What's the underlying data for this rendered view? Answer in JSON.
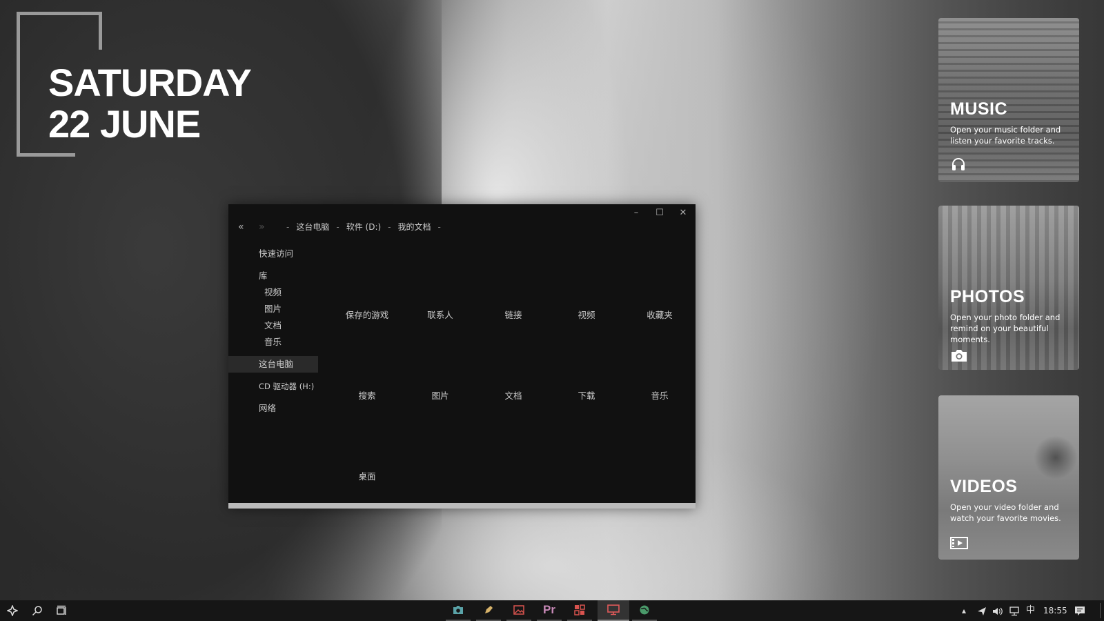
{
  "date_widget": {
    "line1": "SATURDAY",
    "line2": "22 JUNE"
  },
  "explorer": {
    "nav": {
      "back": "«",
      "forward": "»"
    },
    "breadcrumb": [
      "这台电脑",
      "软件 (D:)",
      "我的文档"
    ],
    "sidebar": {
      "quick_access": "快速访问",
      "libraries": "库",
      "lib_items": [
        "视频",
        "图片",
        "文档",
        "音乐"
      ],
      "this_pc": "这台电脑",
      "cd_drive": "CD 驱动器 (H:)",
      "network": "网络"
    },
    "folders": [
      "保存的游戏",
      "联系人",
      "链接",
      "视频",
      "收藏夹",
      "搜索",
      "图片",
      "文档",
      "下载",
      "音乐",
      "桌面"
    ]
  },
  "cards": {
    "music": {
      "title": "MUSIC",
      "desc": "Open your music folder and listen your favorite tracks.",
      "icon": "headphones-icon"
    },
    "photos": {
      "title": "PHOTOS",
      "desc": "Open your photo folder and remind on your beautiful moments.",
      "icon": "camera-icon"
    },
    "videos": {
      "title": "VIDEOS",
      "desc": "Open your video folder and watch your favorite movies.",
      "icon": "film-icon"
    }
  },
  "taskbar": {
    "apps": [
      "camera-app",
      "pen-app",
      "image-app",
      "premiere-app",
      "tiles-app",
      "monitor-app",
      "globe-app"
    ],
    "premiere_label": "Pr",
    "ime": "中",
    "time": "18:55"
  }
}
